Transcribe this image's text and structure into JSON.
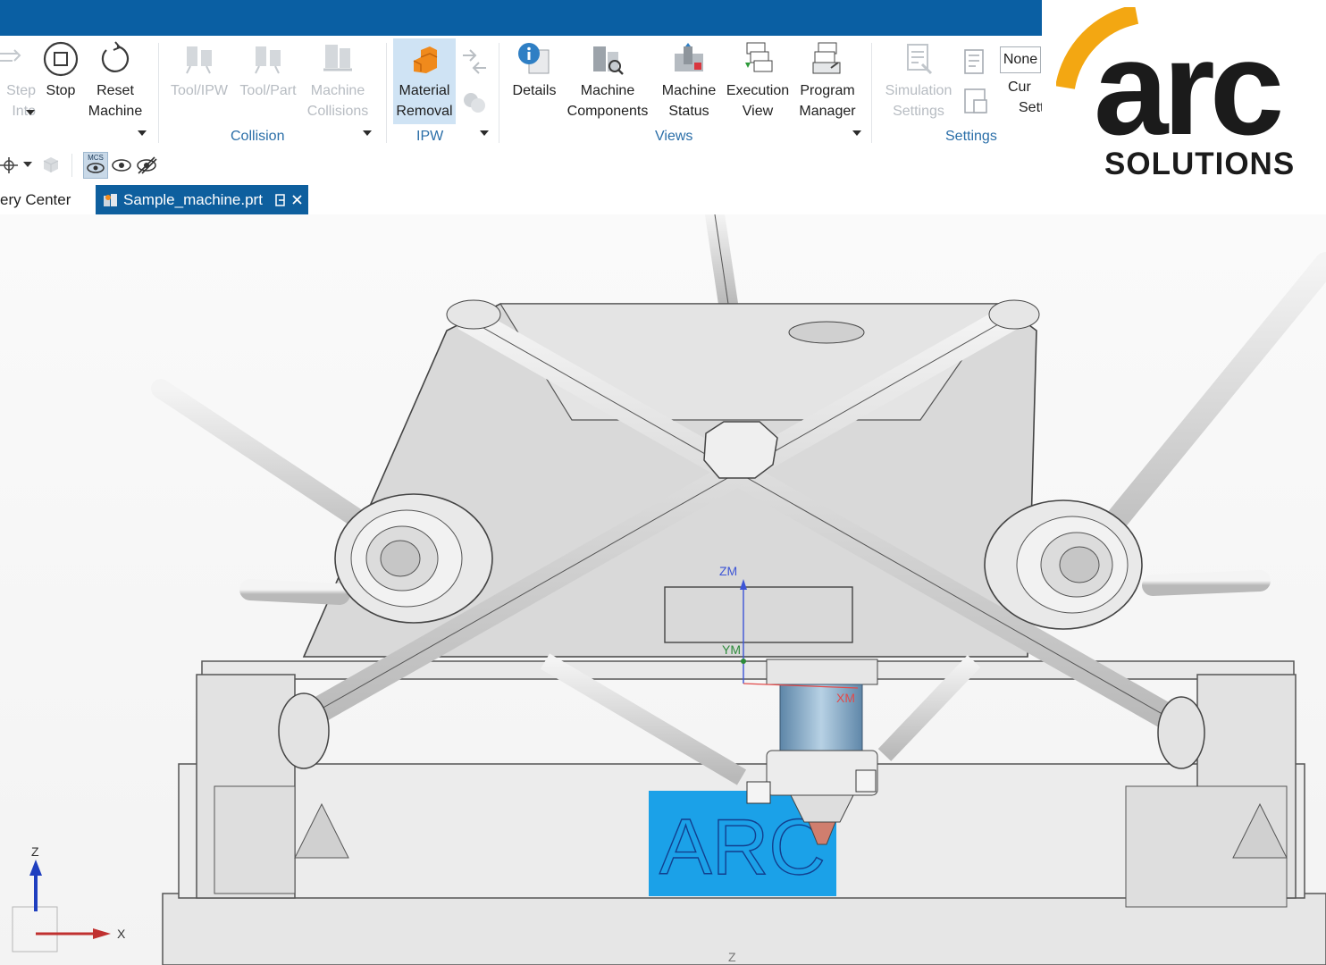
{
  "colors": {
    "titlebar": "#0a5fa3",
    "accent": "#0e5f9e",
    "group_label": "#2a6ea8",
    "disabled_text": "#b7bcc2",
    "logo_orange": "#f3a712",
    "logo_dark": "#1b1b1b",
    "workpiece_blue": "#1ba1e8"
  },
  "ribbon": {
    "step_into": {
      "line1": "Step",
      "line2": "Into"
    },
    "stop": {
      "label": "Stop"
    },
    "reset_machine": {
      "line1": "Reset",
      "line2": "Machine"
    },
    "tool_ipw": {
      "label": "Tool/IPW"
    },
    "tool_part": {
      "label": "Tool/Part"
    },
    "machine_collisions": {
      "line1": "Machine",
      "line2": "Collisions"
    },
    "material_removal": {
      "line1": "Material",
      "line2": "Removal"
    },
    "details": {
      "label": "Details"
    },
    "machine_components": {
      "line1": "Machine",
      "line2": "Components"
    },
    "machine_status": {
      "line1": "Machine",
      "line2": "Status"
    },
    "execution_view": {
      "line1": "Execution",
      "line2": "View"
    },
    "program_manager": {
      "line1": "Program",
      "line2": "Manager"
    },
    "simulation_settings": {
      "line1": "Simulation",
      "line2": "Settings"
    },
    "none_dropdown": "None",
    "cur_settings": {
      "line1": "Cur",
      "line2": "Sett"
    },
    "groups": {
      "collision": "Collision",
      "ipw": "IPW",
      "views": "Views",
      "settings": "Settings"
    }
  },
  "quick_access": {
    "icons": [
      "snap-point-icon",
      "shaded-cube-icon",
      "mcs-display-icon",
      "show-icon",
      "hide-icon"
    ],
    "mcs_label": "MCS"
  },
  "tabs": [
    {
      "label": "ery Center",
      "active": false
    },
    {
      "label": "Sample_machine.prt",
      "active": true
    }
  ],
  "viewport": {
    "workpiece_text": "ARC",
    "axis_labels": {
      "zm": "ZM",
      "ym": "YM",
      "xm": "XM"
    },
    "triad": {
      "z": "Z",
      "x": "X"
    },
    "bottom_mark": "Z"
  },
  "logo": {
    "text": "arc",
    "subtitle": "SOLUTIONS"
  }
}
